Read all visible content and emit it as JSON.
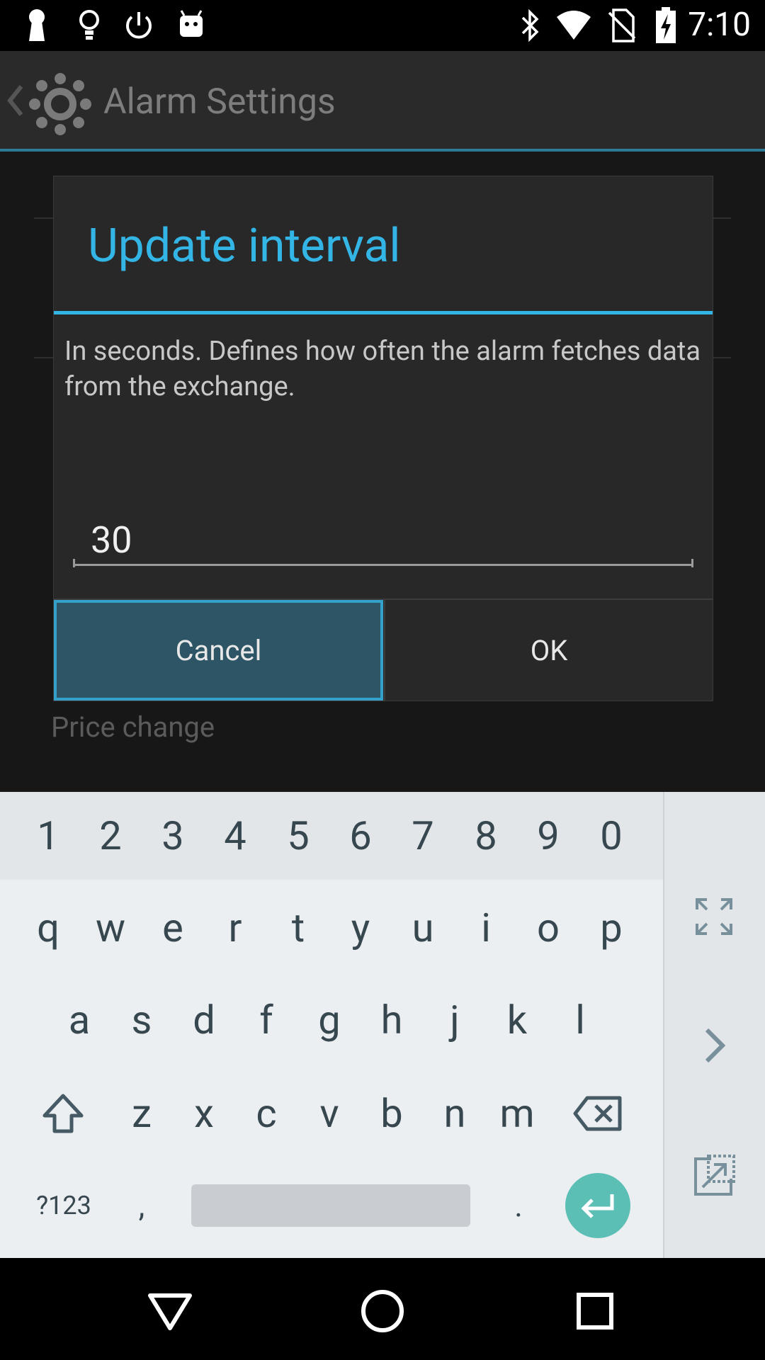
{
  "status_bar": {
    "time": "7:10",
    "left_icons": [
      "keyhole-icon",
      "lightbulb-icon",
      "power-icon",
      "android-icon"
    ],
    "right_icons": [
      "bluetooth-icon",
      "wifi-icon",
      "no-sim-icon",
      "battery-charging-icon"
    ]
  },
  "app_bar": {
    "title": "Alarm Settings",
    "back_icon": "chevron-left-icon",
    "app_icon": "gear-icon"
  },
  "background": {
    "visible_item_label": "Price change"
  },
  "dialog": {
    "title": "Update interval",
    "message": "In seconds. Defines how often the alarm fetches data from the exchange.",
    "input_value": "30",
    "cancel_label": "Cancel",
    "ok_label": "OK"
  },
  "keyboard": {
    "number_row": [
      "1",
      "2",
      "3",
      "4",
      "5",
      "6",
      "7",
      "8",
      "9",
      "0"
    ],
    "row1": [
      "q",
      "w",
      "e",
      "r",
      "t",
      "y",
      "u",
      "i",
      "o",
      "p"
    ],
    "row2": [
      "a",
      "s",
      "d",
      "f",
      "g",
      "h",
      "j",
      "k",
      "l"
    ],
    "row3": [
      "z",
      "x",
      "c",
      "v",
      "b",
      "n",
      "m"
    ],
    "symbols_label": "?123",
    "comma_label": ",",
    "period_label": ".",
    "side_icons": [
      "expand-icon",
      "chevron-right-icon",
      "popout-icon"
    ]
  },
  "nav_bar": {
    "icons": [
      "back-triangle-icon",
      "home-circle-icon",
      "recents-square-icon"
    ]
  },
  "colors": {
    "accent": "#33b5e5",
    "cancel_bg": "#2e5565",
    "enter_key": "#5bbfb5"
  }
}
